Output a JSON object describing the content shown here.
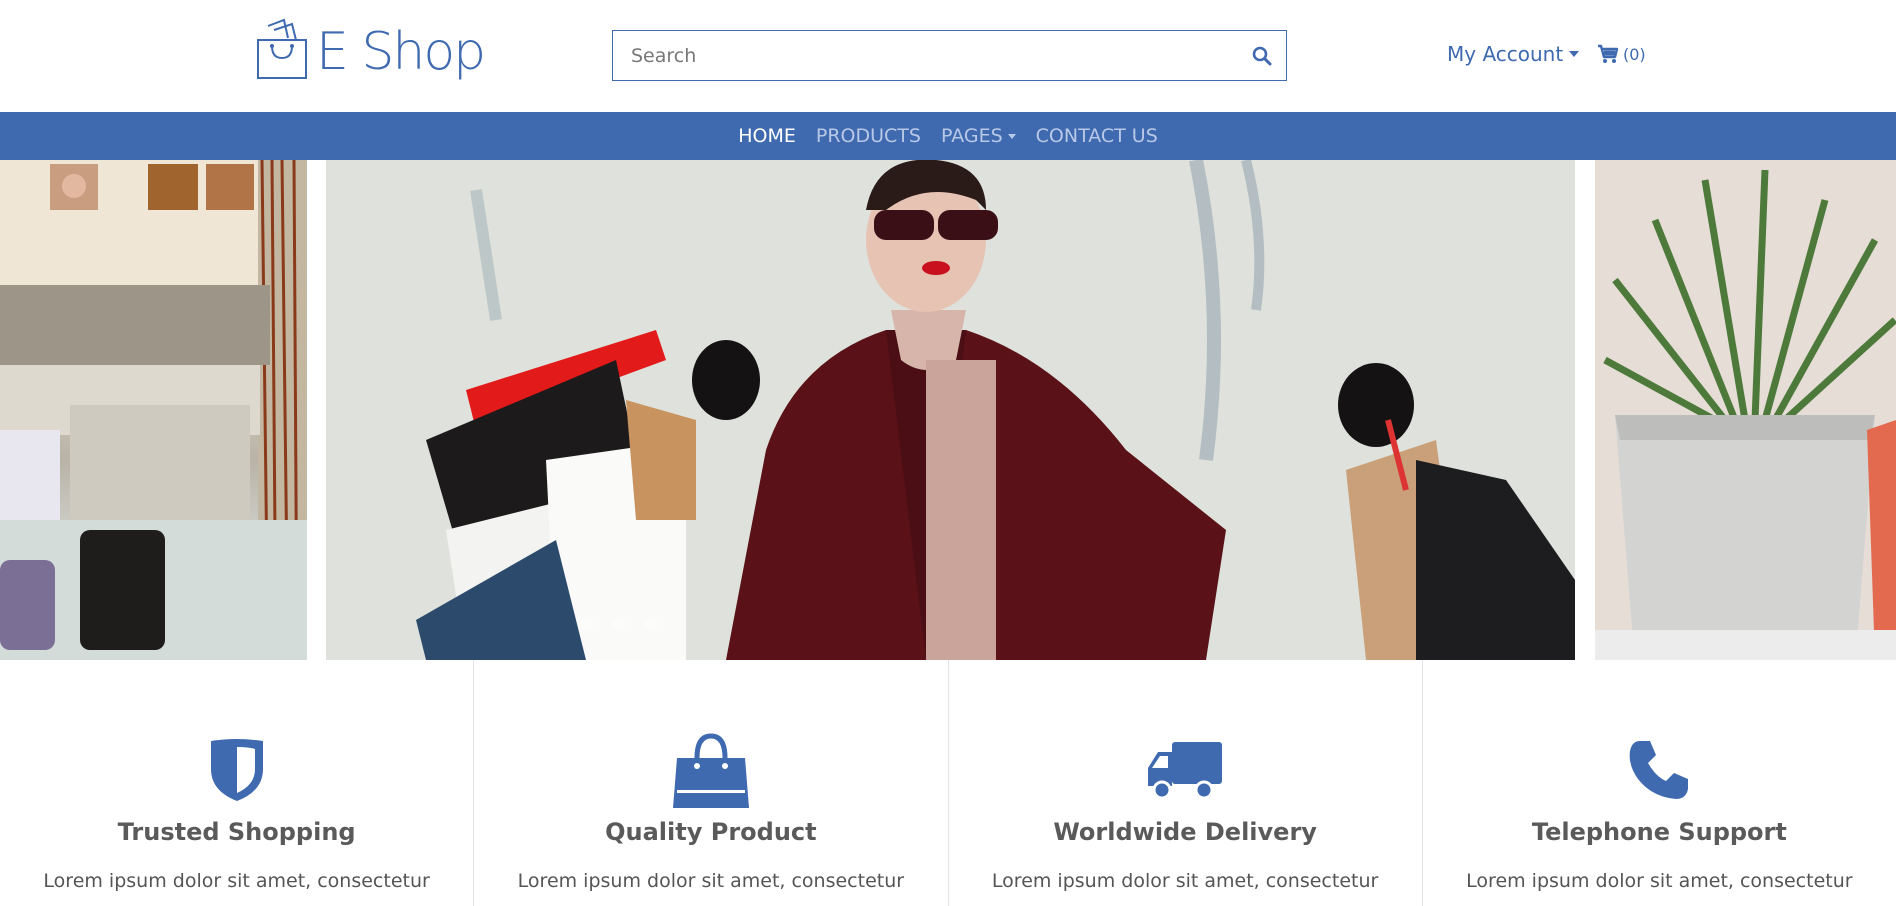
{
  "brand": {
    "name": "E Shop",
    "color": "#3f6ab0"
  },
  "search": {
    "placeholder": "Search",
    "icon": "search-icon"
  },
  "account": {
    "label": "My Account",
    "icon": "caret-down-icon"
  },
  "cart": {
    "count_label": "(0)",
    "icon": "shopping-cart-icon"
  },
  "nav": {
    "items": [
      {
        "label": "HOME",
        "active": true
      },
      {
        "label": "PRODUCTS",
        "active": false
      },
      {
        "label": "PAGES",
        "active": false,
        "dropdown": true
      },
      {
        "label": "CONTACT US",
        "active": false
      }
    ]
  },
  "carousel": {
    "slides": [
      "store-interior",
      "woman-with-shopping-bags",
      "potted-plants"
    ],
    "active_index": 0,
    "dot_count": 3
  },
  "features": [
    {
      "icon": "shield-icon",
      "title": "Trusted Shopping",
      "text": "Lorem ipsum dolor sit amet, consectetur"
    },
    {
      "icon": "shopping-bag-icon",
      "title": "Quality Product",
      "text": "Lorem ipsum dolor sit amet, consectetur"
    },
    {
      "icon": "truck-icon",
      "title": "Worldwide Delivery",
      "text": "Lorem ipsum dolor sit amet, consectetur"
    },
    {
      "icon": "phone-icon",
      "title": "Telephone Support",
      "text": "Lorem ipsum dolor sit amet, consectetur"
    }
  ]
}
